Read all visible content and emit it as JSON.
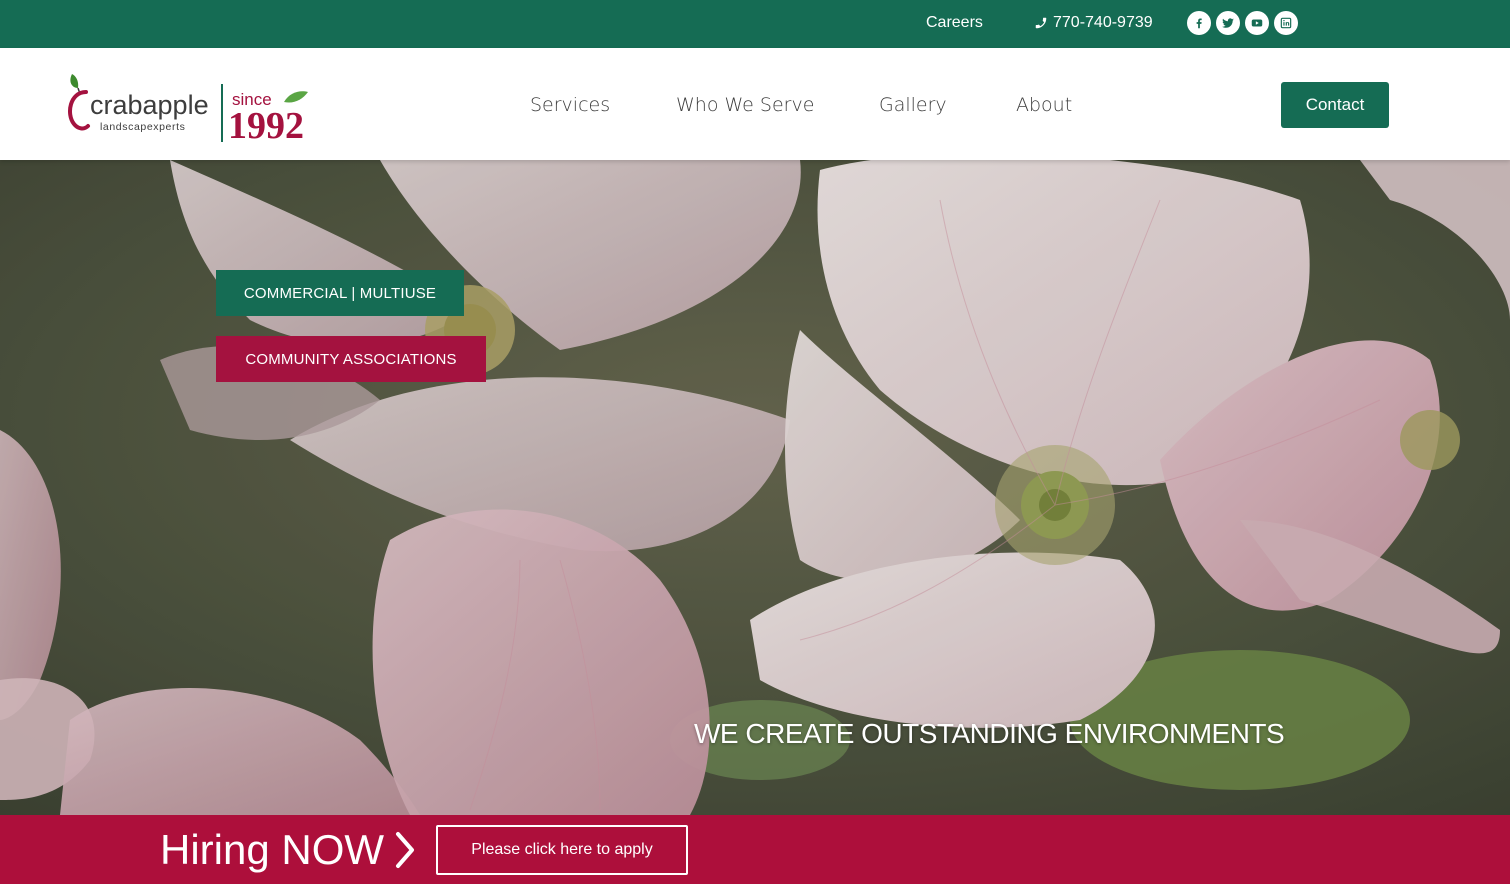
{
  "topbar": {
    "careers_label": "Careers",
    "phone": "770-740-9739",
    "social_icons": [
      "facebook-icon",
      "twitter-icon",
      "youtube-icon",
      "linkedin-icon"
    ],
    "color": "#156c54"
  },
  "header": {
    "logo": {
      "brand": "crabapple",
      "sub": "landscapexperts",
      "since": "since",
      "year": "1992"
    },
    "nav": [
      {
        "label": "Services"
      },
      {
        "label": "Who We Serve"
      },
      {
        "label": "Gallery"
      },
      {
        "label": "About"
      }
    ],
    "contact_label": "Contact"
  },
  "hero": {
    "buttons": {
      "commercial": "COMMERCIAL | MULTIUSE",
      "community": "COMMUNITY ASSOCIATIONS"
    },
    "tagline": "WE CREATE OUTSTANDING ENVIRONMENTS"
  },
  "hiring": {
    "title": "Hiring NOW",
    "apply_label": "Please click here to apply",
    "color": "#ad0f3b"
  }
}
